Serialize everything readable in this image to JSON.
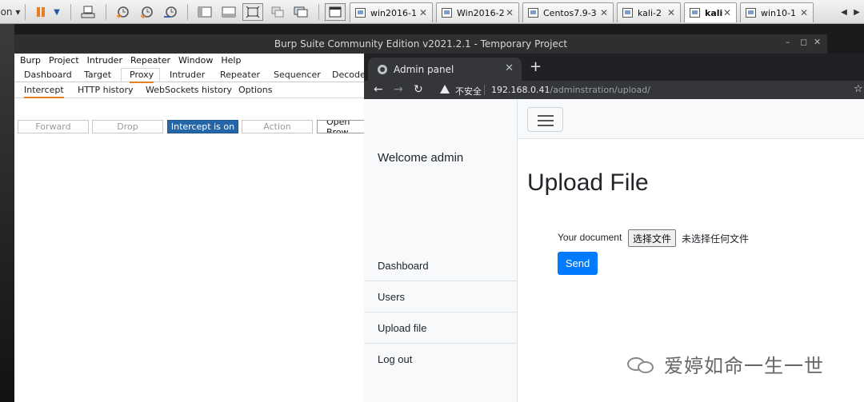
{
  "vm_toolbar": {
    "left_label": "on",
    "tabs": [
      {
        "label": "win2016-1",
        "active": false
      },
      {
        "label": "Win2016-2",
        "active": false
      },
      {
        "label": "Centos7.9-3",
        "active": false
      },
      {
        "label": "kali-2",
        "active": false
      },
      {
        "label": "kali",
        "active": true
      },
      {
        "label": "win10-1",
        "active": false
      }
    ]
  },
  "burp": {
    "title": "Burp Suite Community Edition v2021.2.1 - Temporary Project",
    "menu": [
      "Burp",
      "Project",
      "Intruder",
      "Repeater",
      "Window",
      "Help"
    ],
    "tools": [
      "Dashboard",
      "Target",
      "Proxy",
      "Intruder",
      "Repeater",
      "Sequencer",
      "Decoder"
    ],
    "proxy_tabs": [
      "Intercept",
      "HTTP history",
      "WebSockets history",
      "Options"
    ],
    "buttons": {
      "forward": "Forward",
      "drop": "Drop",
      "intercept": "Intercept is on",
      "action": "Action",
      "open_browser": "Open Brow"
    }
  },
  "browser": {
    "tab_title": "Admin panel",
    "security_label": "不安全",
    "url_host": "192.168.0.41",
    "url_path": "/adminstration/upload/",
    "welcome": "Welcome admin",
    "nav": [
      "Dashboard",
      "Users",
      "Upload file",
      "Log out"
    ],
    "page_title": "Upload File",
    "document_label": "Your document",
    "choose_file": "选择文件",
    "no_file": "未选择任何文件",
    "send": "Send",
    "colors": {
      "primary": "#007bff",
      "intercept_on": "#2566a8"
    }
  },
  "watermark": "爱婷如命一生一世"
}
